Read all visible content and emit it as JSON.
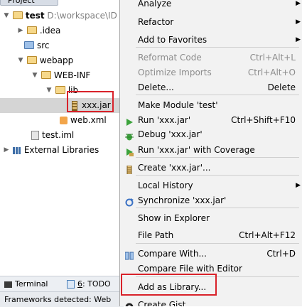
{
  "project_panel": {
    "header": "Project",
    "tree": [
      {
        "label": "test",
        "path": "D:\\workspace\\ID",
        "icon": "module-folder-icon",
        "arrow": "▼"
      },
      {
        "label": ".idea",
        "icon": "folder-icon",
        "arrow": "▶"
      },
      {
        "label": "src",
        "icon": "source-folder-icon",
        "arrow": ""
      },
      {
        "label": "webapp",
        "icon": "folder-icon",
        "arrow": "▼"
      },
      {
        "label": "WEB-INF",
        "icon": "folder-icon",
        "arrow": "▼"
      },
      {
        "label": "lib",
        "icon": "folder-icon",
        "arrow": "▼"
      },
      {
        "label": "xxx.jar",
        "icon": "jar-icon",
        "arrow": ""
      },
      {
        "label": "web.xml",
        "icon": "xml-file-icon",
        "arrow": ""
      },
      {
        "label": "test.iml",
        "icon": "iml-file-icon",
        "arrow": ""
      },
      {
        "label": "External Libraries",
        "icon": "libraries-icon",
        "arrow": "▶"
      }
    ]
  },
  "bottom_bar": {
    "terminal_label": "Terminal",
    "todo_number": "6",
    "todo_label": ": TODO"
  },
  "status_bar": {
    "text": "Frameworks detected: Web"
  },
  "context_menu": {
    "items": [
      {
        "label": "Analyze",
        "shortcut": "",
        "submenu": true,
        "disabled": false,
        "icon": ""
      },
      {
        "label": "Refactor",
        "shortcut": "",
        "submenu": true,
        "disabled": false,
        "icon": ""
      },
      {
        "label": "Add to Favorites",
        "shortcut": "",
        "submenu": true,
        "disabled": false,
        "icon": ""
      },
      {
        "label": "Reformat Code",
        "shortcut": "Ctrl+Alt+L",
        "submenu": false,
        "disabled": true,
        "icon": ""
      },
      {
        "label": "Optimize Imports",
        "shortcut": "Ctrl+Alt+O",
        "submenu": false,
        "disabled": true,
        "icon": ""
      },
      {
        "label": "Delete...",
        "shortcut": "Delete",
        "submenu": false,
        "disabled": false,
        "icon": ""
      },
      {
        "label": "Make Module 'test'",
        "shortcut": "",
        "submenu": false,
        "disabled": false,
        "icon": ""
      },
      {
        "label": "Run 'xxx.jar'",
        "shortcut": "Ctrl+Shift+F10",
        "submenu": false,
        "disabled": false,
        "icon": "run-icon"
      },
      {
        "label": "Debug 'xxx.jar'",
        "shortcut": "",
        "submenu": false,
        "disabled": false,
        "icon": "debug-icon"
      },
      {
        "label": "Run 'xxx.jar' with Coverage",
        "shortcut": "",
        "submenu": false,
        "disabled": false,
        "icon": "coverage-icon"
      },
      {
        "label": "Create 'xxx.jar'...",
        "shortcut": "",
        "submenu": false,
        "disabled": false,
        "icon": "jar-icon"
      },
      {
        "label": "Local History",
        "shortcut": "",
        "submenu": true,
        "disabled": false,
        "icon": ""
      },
      {
        "label": "Synchronize 'xxx.jar'",
        "shortcut": "",
        "submenu": false,
        "disabled": false,
        "icon": "sync-icon"
      },
      {
        "label": "Show in Explorer",
        "shortcut": "",
        "submenu": false,
        "disabled": false,
        "icon": ""
      },
      {
        "label": "File Path",
        "shortcut": "Ctrl+Alt+F12",
        "submenu": false,
        "disabled": false,
        "icon": ""
      },
      {
        "label": "Compare With...",
        "shortcut": "Ctrl+D",
        "submenu": false,
        "disabled": false,
        "icon": "compare-icon"
      },
      {
        "label": "Compare File with Editor",
        "shortcut": "",
        "submenu": false,
        "disabled": false,
        "icon": ""
      },
      {
        "label": "Add as Library...",
        "shortcut": "",
        "submenu": false,
        "disabled": false,
        "icon": ""
      },
      {
        "label": "Create Gist...",
        "shortcut": "",
        "submenu": false,
        "disabled": false,
        "icon": "github-icon"
      }
    ]
  },
  "colors": {
    "menu_background": "#f2f2f2",
    "menu_selection": "#3875d7",
    "highlight_box": "#d9222a",
    "tree_selection": "#d5d5d5"
  }
}
